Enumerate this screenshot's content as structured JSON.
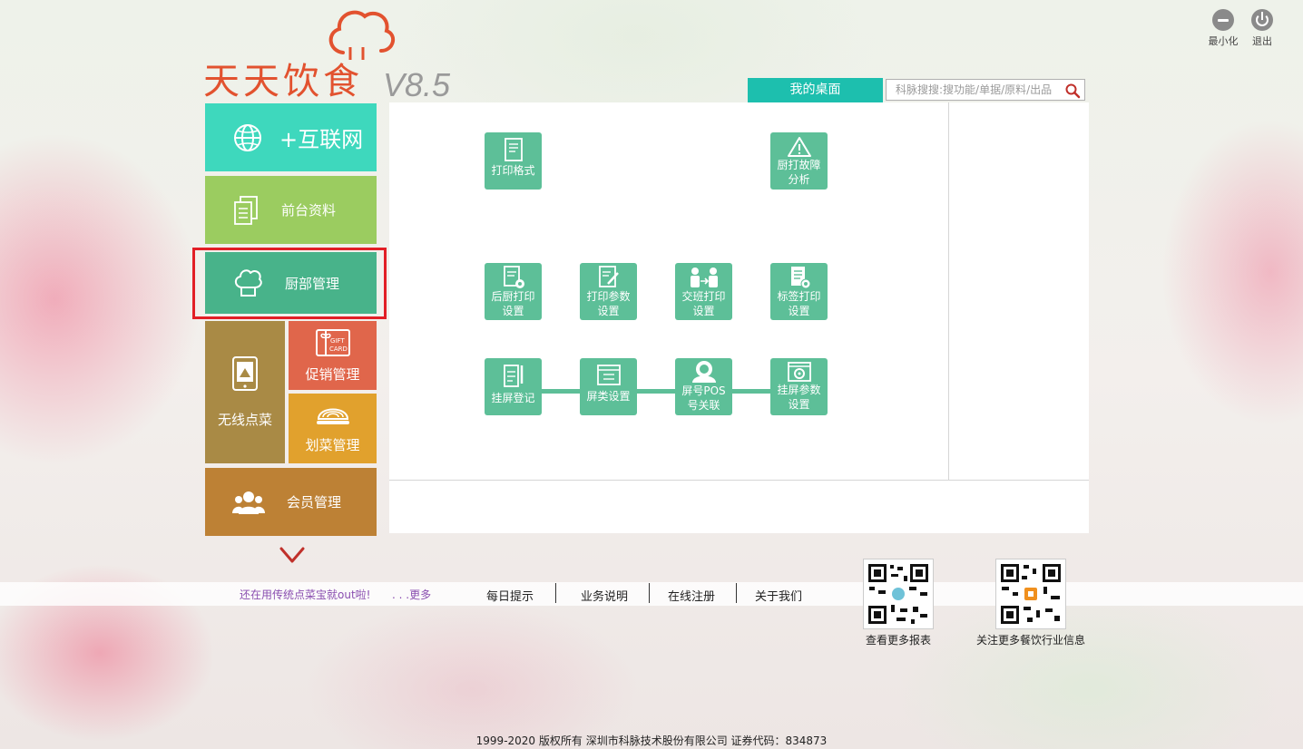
{
  "window": {
    "minimize_label": "最小化",
    "exit_label": "退出"
  },
  "logo": {
    "name": "天天饮食",
    "version": "V8.5"
  },
  "header": {
    "tab_label": "我的桌面",
    "search_placeholder": "科脉搜搜:搜功能/单据/原料/出品"
  },
  "sidebar": {
    "items": [
      {
        "label": "+互联网",
        "color": "#3ed8bd",
        "icon": "globe-icon"
      },
      {
        "label": "前台资料",
        "color": "#9bcc60",
        "icon": "documents-icon"
      },
      {
        "label": "厨部管理",
        "color": "#48b38a",
        "icon": "chef-hat-icon",
        "selected": true
      },
      {
        "label": "无线点菜",
        "color": "#a98a45",
        "icon": "tablet-icon"
      },
      {
        "label": "促销管理",
        "color": "#e0664b",
        "icon": "gift-card-icon"
      },
      {
        "label": "划菜管理",
        "color": "#e1a12d",
        "icon": "dish-icon"
      },
      {
        "label": "会员管理",
        "color": "#bd8135",
        "icon": "members-icon"
      }
    ],
    "gift_card_text": "GIFT CARD"
  },
  "functions": {
    "print_format": "打印格式",
    "kitchen_fault": "厨打故障\n分析",
    "back_kitchen_print": "后厨打印\n设置",
    "print_params": "打印参数\n设置",
    "shift_print": "交班打印\n设置",
    "label_print": "标签打印\n设置",
    "hang_register": "挂屏登记",
    "screen_class": "屏类设置",
    "screen_pos_link": "屏号POS\n号关联",
    "hang_params": "挂屏参数\n设置",
    "accent_color": "#5dbf98"
  },
  "infobar": {
    "tip": "还在用传统点菜宝就out啦!",
    "more": ". . .更多",
    "links": [
      "每日提示",
      "业务说明",
      "在线注册",
      "关于我们"
    ]
  },
  "qrcodes": [
    {
      "caption": "查看更多报表"
    },
    {
      "caption": "关注更多餐饮行业信息"
    }
  ],
  "footer": {
    "copyright": "1999-2020  版权所有   深圳市科脉技术股份有限公司  证券代码：834873"
  }
}
